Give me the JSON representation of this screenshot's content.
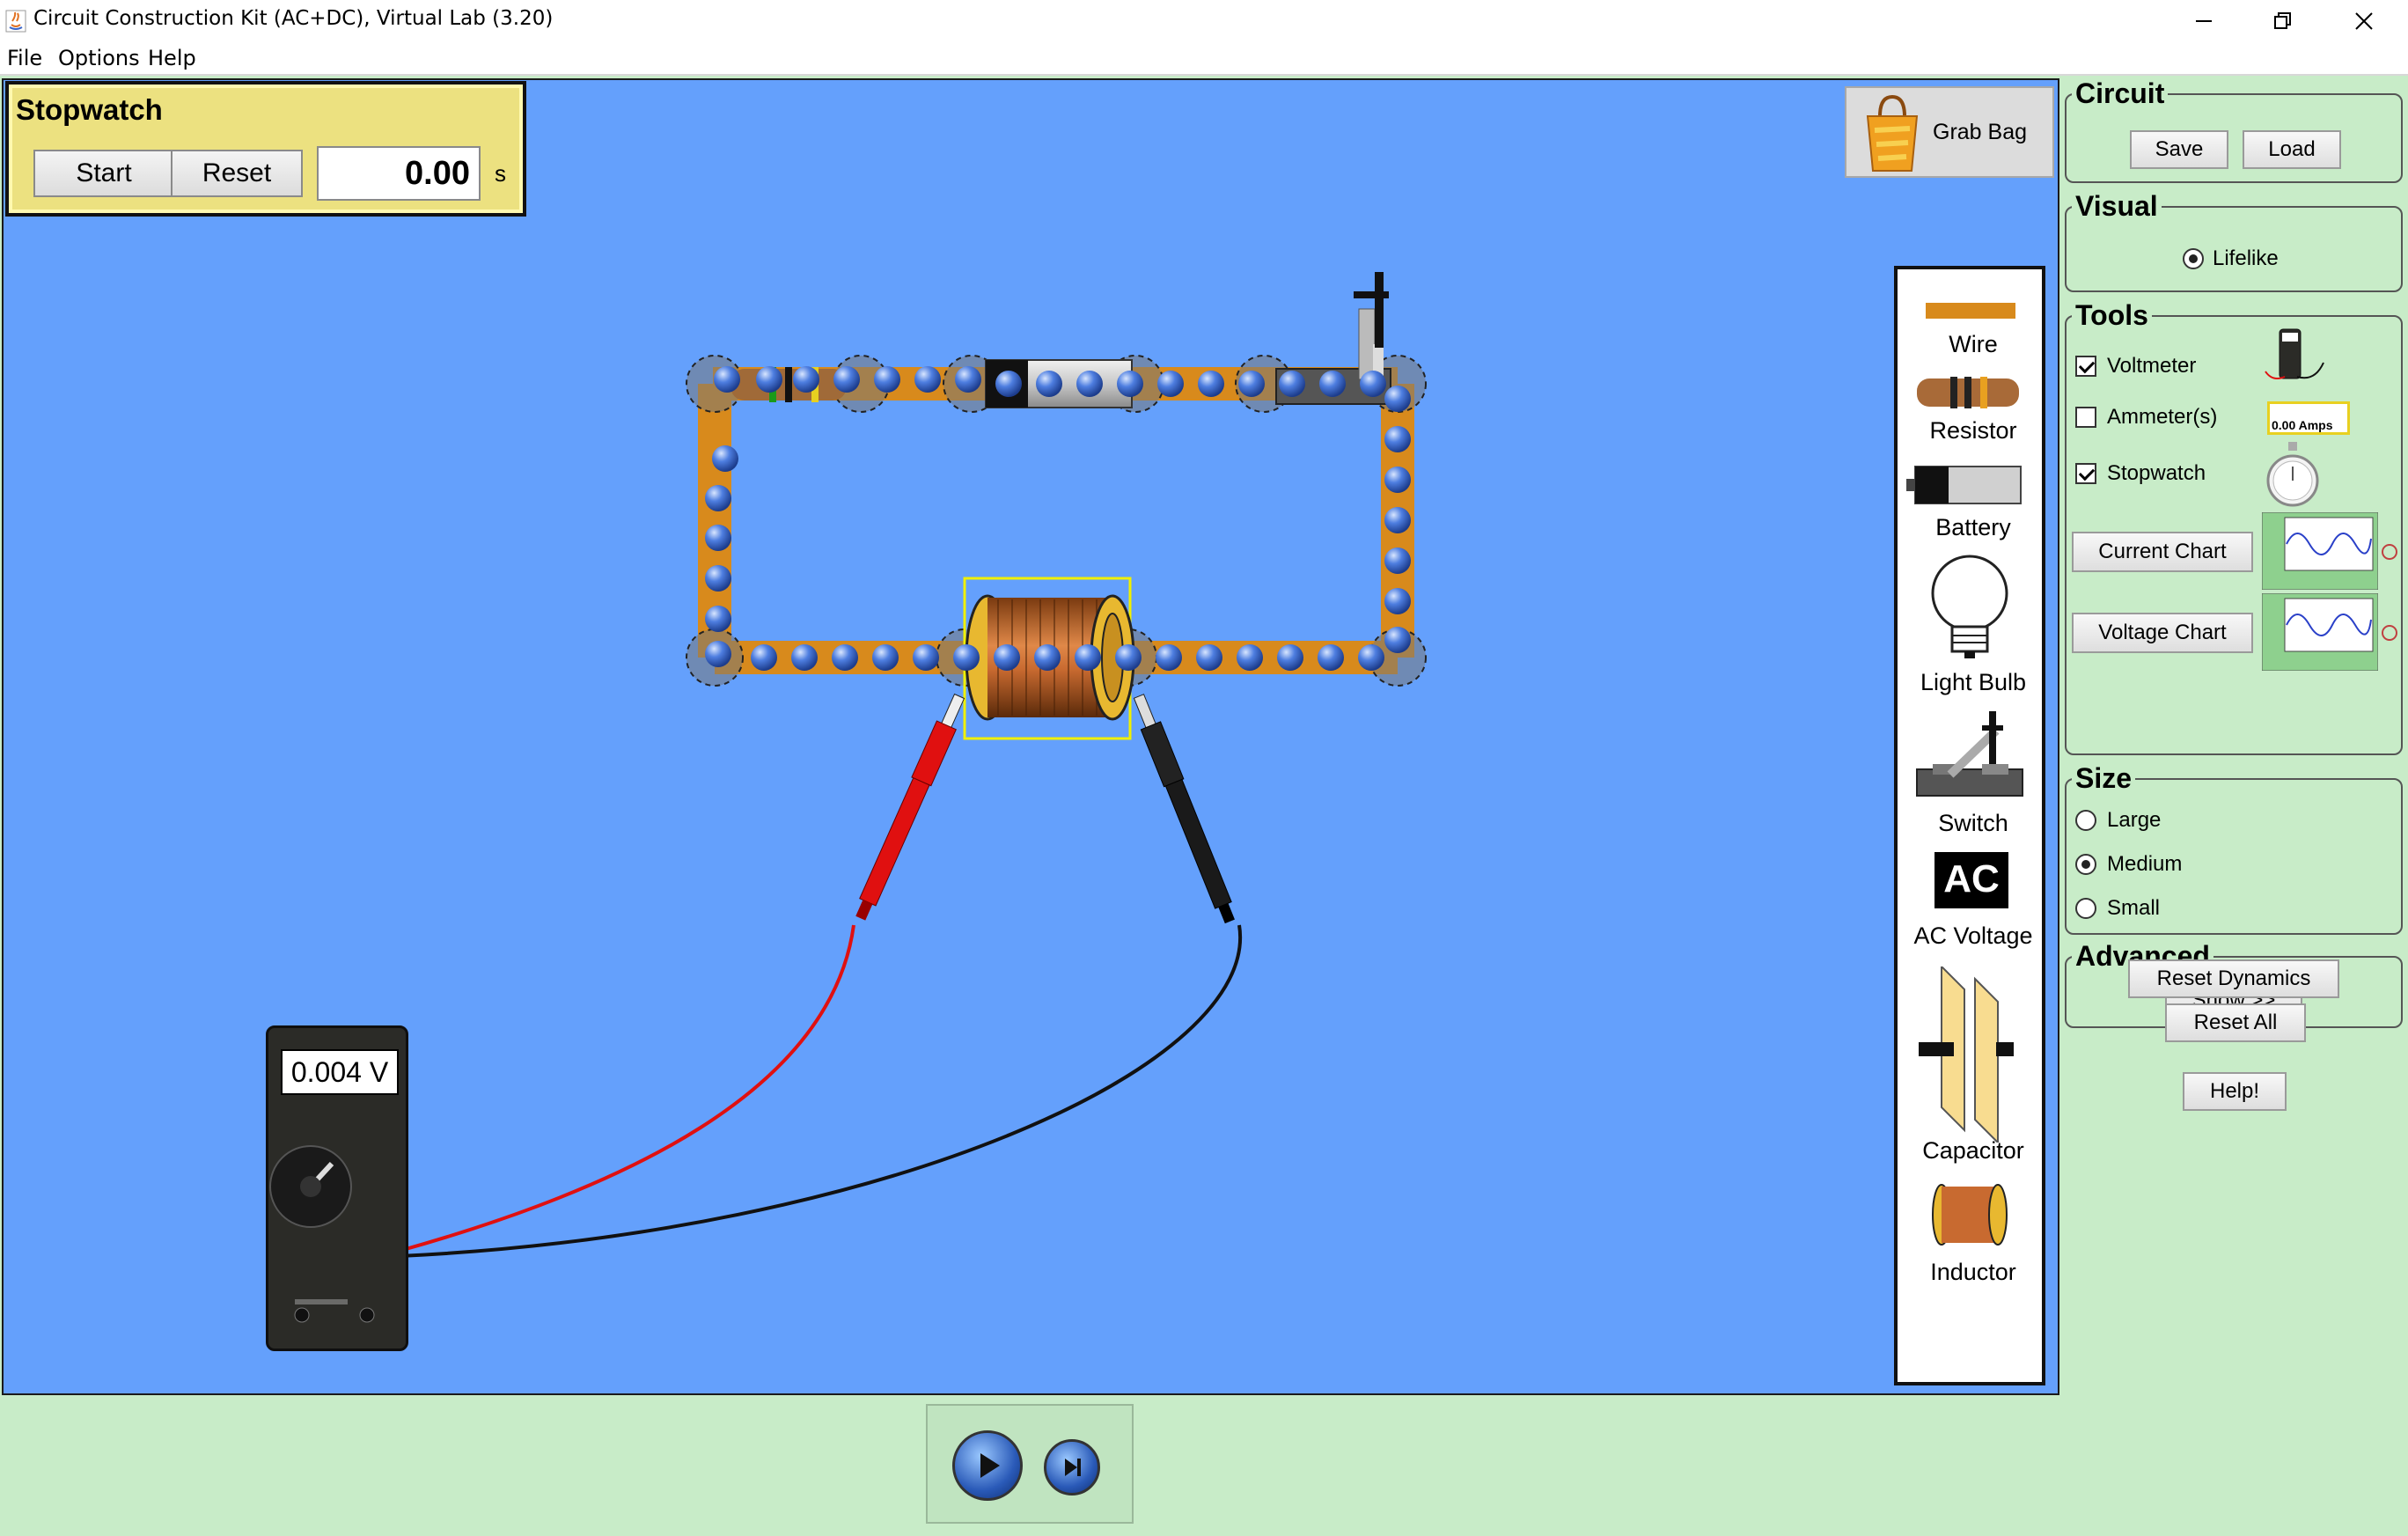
{
  "window": {
    "title": "Circuit Construction Kit (AC+DC), Virtual Lab (3.20)",
    "controls": [
      "minimize-icon",
      "maximize-icon",
      "close-icon"
    ]
  },
  "menu": {
    "items": [
      "File",
      "Options",
      "Help"
    ]
  },
  "stopwatch": {
    "title": "Stopwatch",
    "start_label": "Start",
    "reset_label": "Reset",
    "time": "0.00",
    "unit": "s"
  },
  "grab_bag": {
    "label": "Grab Bag"
  },
  "toolbox": {
    "items": [
      "Wire",
      "Resistor",
      "Battery",
      "Light Bulb",
      "Switch",
      "AC Voltage",
      "Capacitor",
      "Inductor"
    ],
    "ac_icon_text": "AC"
  },
  "voltmeter": {
    "reading": "0.004 V"
  },
  "panel": {
    "circuit": {
      "title": "Circuit",
      "save": "Save",
      "load": "Load"
    },
    "visual": {
      "title": "Visual",
      "option": "Lifelike",
      "selected": true
    },
    "tools": {
      "title": "Tools",
      "voltmeter": {
        "label": "Voltmeter",
        "checked": true
      },
      "ammeter": {
        "label": "Ammeter(s)",
        "checked": false,
        "icon_text": "0.00 Amps"
      },
      "stopwatch": {
        "label": "Stopwatch",
        "checked": true
      },
      "current_chart": "Current Chart",
      "voltage_chart": "Voltage Chart"
    },
    "size": {
      "title": "Size",
      "options": [
        "Large",
        "Medium",
        "Small"
      ],
      "selected": "Medium"
    },
    "advanced": {
      "title": "Advanced",
      "show": "Show >>"
    },
    "reset_dynamics": "Reset Dynamics",
    "reset_all": "Reset All",
    "help": "Help!"
  },
  "colors": {
    "canvas": "#64a0fc",
    "panel": "#c8ecc8",
    "wire": "#d88a1c",
    "electron": "#3a64c8",
    "stopwatch_bg": "#ece180",
    "selection": "#f0f000"
  }
}
